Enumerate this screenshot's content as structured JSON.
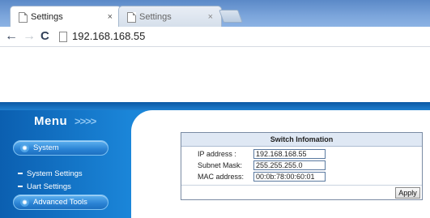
{
  "browser": {
    "tabs": [
      {
        "title": "Settings",
        "close": "×"
      },
      {
        "title": "Settings",
        "close": "×"
      }
    ],
    "nav": {
      "back": "←",
      "forward": "→",
      "reload": "C"
    },
    "address": "192.168.168.55"
  },
  "sidebar": {
    "title": "Menu",
    "arrows": ">>>>",
    "system_label": "System",
    "links": [
      {
        "label": "System Settings"
      },
      {
        "label": "Uart Settings"
      }
    ],
    "advanced_label": "Advanced Tools"
  },
  "switch_info": {
    "header": "Switch Infomation",
    "rows": [
      {
        "label": "IP address :",
        "value": "192.168.168.55"
      },
      {
        "label": "Subnet Mask:",
        "value": "255.255.255.0"
      },
      {
        "label": "MAC address:",
        "value": "00:0b:78:00:60:01"
      }
    ],
    "apply_label": "Apply"
  },
  "colors": {
    "tabstrip": "#79a3da",
    "sidebar": "#1273c4",
    "pill": "#2a83d4",
    "panel_header": "#dfe8f4"
  }
}
